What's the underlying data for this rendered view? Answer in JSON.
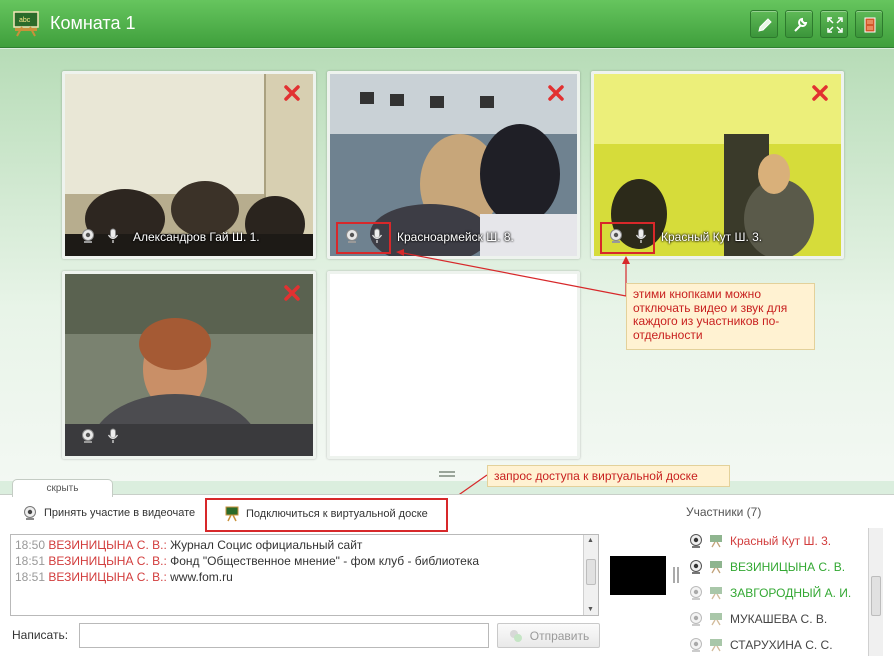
{
  "header": {
    "title": "Комната 1",
    "logo_text": "abc",
    "buttons": [
      {
        "name": "pencil-button",
        "icon": "pencil-icon"
      },
      {
        "name": "settings-button",
        "icon": "wrench-icon"
      },
      {
        "name": "fullscreen-button",
        "icon": "expand-icon"
      },
      {
        "name": "exit-button",
        "icon": "door-icon"
      }
    ]
  },
  "video_tiles": [
    {
      "participant": "Александров Гай Ш. 1."
    },
    {
      "participant": "Красноармейск Ш. 8."
    },
    {
      "participant": "Красный Кут Ш. 3."
    },
    {
      "participant": ""
    },
    {
      "participant": ""
    }
  ],
  "annotations": {
    "controls_note": "этими кнопками можно отключать видео и звук для каждого из участников по-отдельности",
    "board_note": "запрос доступа к виртуальной доске"
  },
  "panel": {
    "hide_tab": "скрыть",
    "join_video_label": "Принять участие в видеочате",
    "connect_board_label": "Подключиться к виртуальной доске",
    "write_label": "Написать:",
    "message_value": "",
    "send_label": "Отправить",
    "chat_messages": [
      {
        "time": "18:50",
        "author": "ВЕЗИНИЦЫНА С. В.:",
        "text": " Журнал Социс официальный сайт"
      },
      {
        "time": "18:51",
        "author": "ВЕЗИНИЦЫНА С. В.:",
        "text": " Фонд \"Общественное мнение\" - фом клуб - библиотека"
      },
      {
        "time": "18:51",
        "author": "ВЕЗИНИЦЫНА С. В.:",
        "text": " www.fom.ru"
      }
    ]
  },
  "participants": {
    "title": "Участники (7)",
    "list": [
      {
        "name": "Красный Кут Ш. 3.",
        "color": "#d23c3c"
      },
      {
        "name": "ВЕЗИНИЦЫНА С. В.",
        "color": "#33a833"
      },
      {
        "name": "ЗАВГОРОДНЫЙ А. И.",
        "color": "#33a833"
      },
      {
        "name": "МУКАШЕВА С. В.",
        "color": "#444444"
      },
      {
        "name": "СТАРУХИНА С. С.",
        "color": "#444444"
      }
    ]
  },
  "colors": {
    "header": "#4caf45",
    "accent_red": "#d7282a",
    "callout_bg": "#fff2d2"
  }
}
